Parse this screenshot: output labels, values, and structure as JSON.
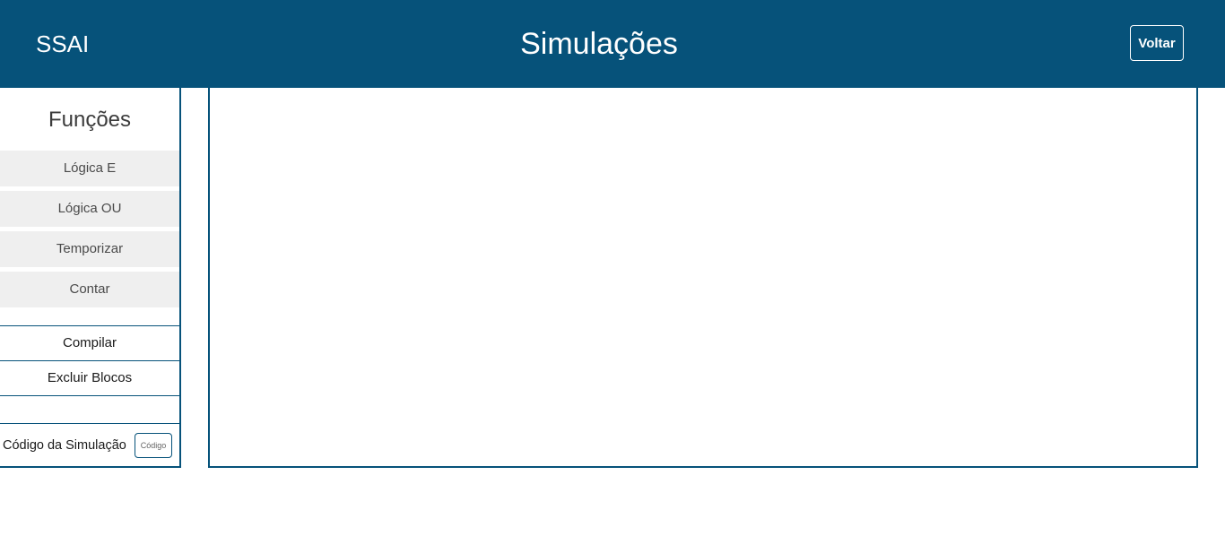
{
  "header": {
    "brand": "SSAI",
    "title": "Simulações",
    "back_label": "Voltar"
  },
  "sidebar": {
    "title": "Funções",
    "functions": [
      {
        "label": "Lógica E"
      },
      {
        "label": "Lógica OU"
      },
      {
        "label": "Temporizar"
      },
      {
        "label": "Contar"
      }
    ],
    "actions": [
      {
        "label": "Compilar"
      },
      {
        "label": "Excluir Blocos"
      }
    ],
    "code": {
      "label": "Código da Simulação",
      "button_label": "Código"
    }
  },
  "colors": {
    "primary": "#06527a",
    "item_bg": "#efefef",
    "text_dark": "#3c3c3c"
  }
}
